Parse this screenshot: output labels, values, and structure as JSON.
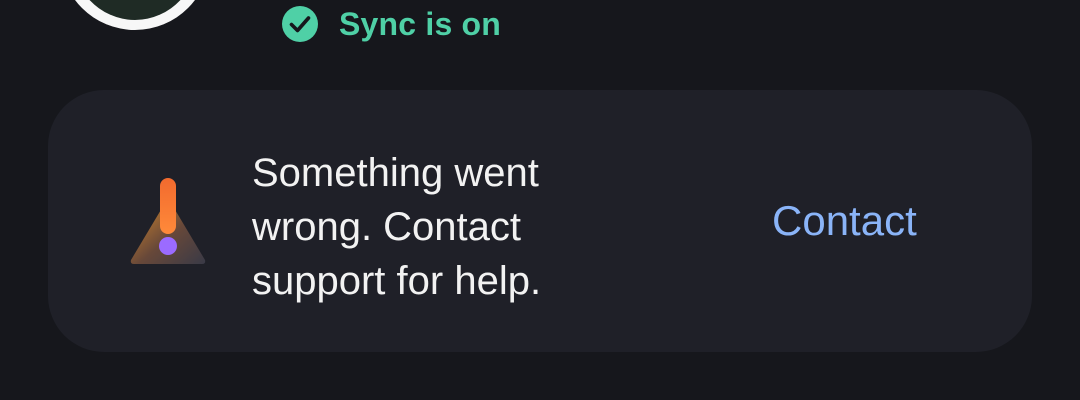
{
  "header": {
    "sync_status": "Sync is on",
    "sync_icon": "check-circle-icon",
    "sync_color": "#4fd0a6"
  },
  "error_card": {
    "icon": "warning-icon",
    "message": "Something went wrong. Contact support for help.",
    "action_label": "Contact",
    "action_color": "#8ab4f8"
  }
}
